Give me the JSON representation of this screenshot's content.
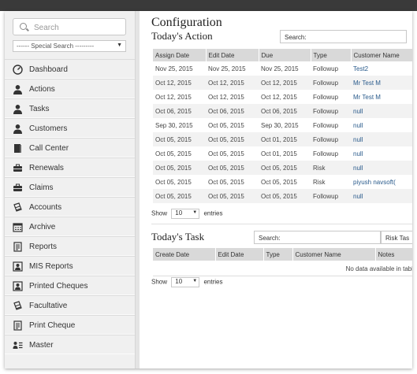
{
  "sidebar": {
    "search_placeholder": "Search",
    "special_search": "------ Special Search ---------",
    "items": [
      {
        "label": "Dashboard",
        "icon": "dashboard-icon"
      },
      {
        "label": "Actions",
        "icon": "user-icon"
      },
      {
        "label": "Tasks",
        "icon": "user-icon"
      },
      {
        "label": "Customers",
        "icon": "user-icon"
      },
      {
        "label": "Call Center",
        "icon": "book-icon"
      },
      {
        "label": "Renewals",
        "icon": "briefcase-icon"
      },
      {
        "label": "Claims",
        "icon": "briefcase-icon"
      },
      {
        "label": "Accounts",
        "icon": "money-icon"
      },
      {
        "label": "Archive",
        "icon": "calendar-icon"
      },
      {
        "label": "Reports",
        "icon": "report-icon"
      },
      {
        "label": "MIS Reports",
        "icon": "contact-card-icon"
      },
      {
        "label": "Printed Cheques",
        "icon": "contact-card-icon"
      },
      {
        "label": "Facultative",
        "icon": "money-icon"
      },
      {
        "label": "Print Cheque",
        "icon": "report-icon"
      },
      {
        "label": "Master",
        "icon": "user-list-icon"
      }
    ]
  },
  "main": {
    "title": "Configuration",
    "todays_action": {
      "heading": "Today's Action",
      "search_label": "Search:",
      "columns": [
        "Assign Date",
        "Edit Date",
        "Due",
        "Type",
        "Customer Name"
      ],
      "rows": [
        [
          "Nov 25, 2015",
          "Nov 25, 2015",
          "Nov 25, 2015",
          "Followup",
          "Test2"
        ],
        [
          "Oct 12, 2015",
          "Oct 12, 2015",
          "Oct 12, 2015",
          "Followup",
          "Mr Test M"
        ],
        [
          "Oct 12, 2015",
          "Oct 12, 2015",
          "Oct 12, 2015",
          "Followup",
          "Mr Test M"
        ],
        [
          "Oct 06, 2015",
          "Oct 06, 2015",
          "Oct 06, 2015",
          "Followup",
          "null"
        ],
        [
          "Sep 30, 2015",
          "Oct 05, 2015",
          "Sep 30, 2015",
          "Followup",
          "null"
        ],
        [
          "Oct 05, 2015",
          "Oct 05, 2015",
          "Oct 01, 2015",
          "Followup",
          "null"
        ],
        [
          "Oct 05, 2015",
          "Oct 05, 2015",
          "Oct 01, 2015",
          "Followup",
          "null"
        ],
        [
          "Oct 05, 2015",
          "Oct 05, 2015",
          "Oct 05, 2015",
          "Risk",
          "null"
        ],
        [
          "Oct 05, 2015",
          "Oct 05, 2015",
          "Oct 05, 2015",
          "Risk",
          "piyush navsoft("
        ],
        [
          "Oct 05, 2015",
          "Oct 05, 2015",
          "Oct 05, 2015",
          "Followup",
          "null"
        ]
      ],
      "show_label": "Show",
      "page_size": "10",
      "entries_label": "entries"
    },
    "todays_task": {
      "heading": "Today's Task",
      "search_label": "Search:",
      "filter_label": "Risk Tas",
      "columns": [
        "Create Date",
        "Edit Date",
        "Type",
        "Customer Name",
        "Notes"
      ],
      "empty_text": "No data available in tabl",
      "show_label": "Show",
      "page_size": "10",
      "entries_label": "entries"
    }
  }
}
